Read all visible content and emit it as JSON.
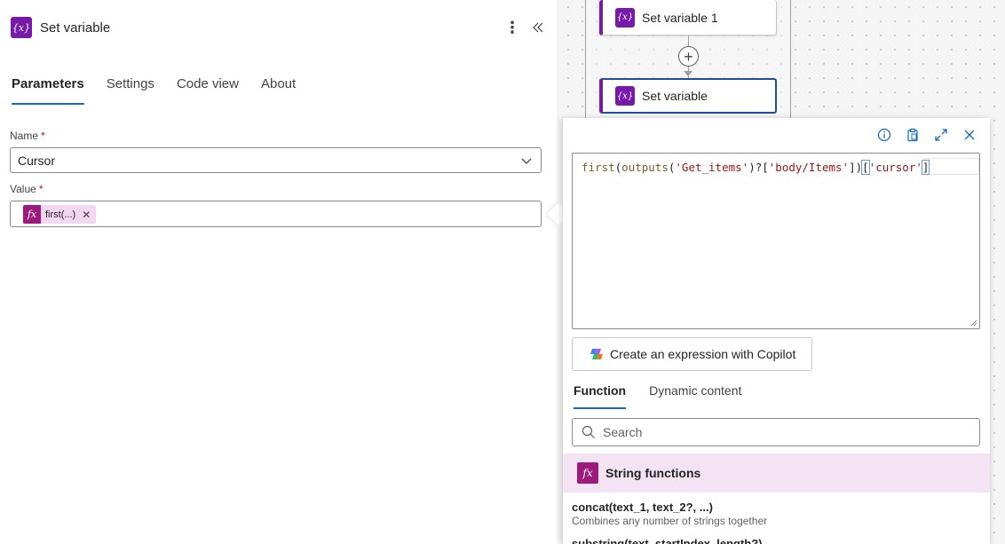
{
  "left_panel": {
    "title": "Set variable",
    "action_icon": "variable-icon",
    "tabs": [
      {
        "label": "Parameters",
        "active": true
      },
      {
        "label": "Settings",
        "active": false
      },
      {
        "label": "Code view",
        "active": false
      },
      {
        "label": "About",
        "active": false
      }
    ],
    "name_field": {
      "label": "Name",
      "required_mark": "*",
      "value": "Cursor"
    },
    "value_field": {
      "label": "Value",
      "required_mark": "*",
      "token_text": "first(...)",
      "token_remove": "✕"
    }
  },
  "canvas": {
    "nodes": [
      {
        "label": "Set variable 1"
      },
      {
        "label": "Set variable"
      }
    ],
    "add_step_glyph": "+"
  },
  "expression_editor": {
    "expression_parts": {
      "fn1": "first",
      "p1": "(",
      "fn2": "outputs",
      "p2": "(",
      "s1": "'Get_items'",
      "p3": ")?[",
      "s2": "'body/Items'",
      "p4": "])",
      "s3": "'cursor'"
    },
    "copilot_button_label": "Create an expression with Copilot",
    "tabs": [
      {
        "label": "Function",
        "active": true
      },
      {
        "label": "Dynamic content",
        "active": false
      }
    ],
    "search_placeholder": "Search",
    "category": {
      "title": "String functions"
    },
    "functions": [
      {
        "signature": "concat(text_1, text_2?, ...)",
        "description": "Combines any number of strings together"
      },
      {
        "signature": "substring(text, startIndex, length?)",
        "description": ""
      }
    ]
  },
  "colors": {
    "variable_purple": "#7719aa",
    "expression_magenta": "#9c1a7b",
    "accent_blue": "#0f6cbd",
    "selected_border": "#1d4fa0"
  }
}
